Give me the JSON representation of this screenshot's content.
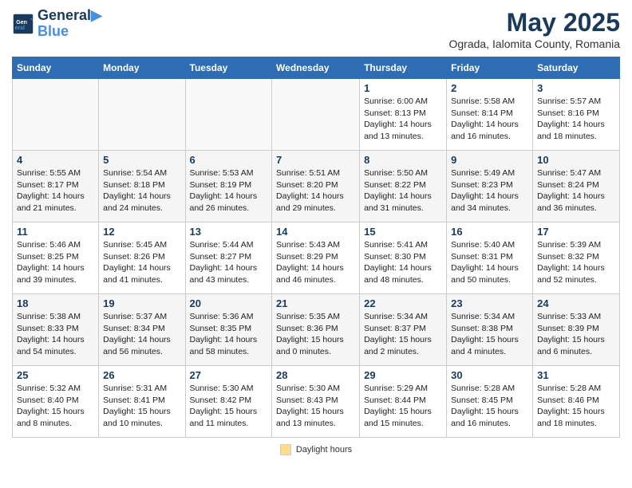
{
  "header": {
    "logo_line1": "General",
    "logo_line2": "Blue",
    "main_title": "May 2025",
    "subtitle": "Ograda, Ialomita County, Romania"
  },
  "days_of_week": [
    "Sunday",
    "Monday",
    "Tuesday",
    "Wednesday",
    "Thursday",
    "Friday",
    "Saturday"
  ],
  "weeks": [
    [
      {
        "num": "",
        "info": ""
      },
      {
        "num": "",
        "info": ""
      },
      {
        "num": "",
        "info": ""
      },
      {
        "num": "",
        "info": ""
      },
      {
        "num": "1",
        "info": "Sunrise: 6:00 AM\nSunset: 8:13 PM\nDaylight: 14 hours\nand 13 minutes."
      },
      {
        "num": "2",
        "info": "Sunrise: 5:58 AM\nSunset: 8:14 PM\nDaylight: 14 hours\nand 16 minutes."
      },
      {
        "num": "3",
        "info": "Sunrise: 5:57 AM\nSunset: 8:16 PM\nDaylight: 14 hours\nand 18 minutes."
      }
    ],
    [
      {
        "num": "4",
        "info": "Sunrise: 5:55 AM\nSunset: 8:17 PM\nDaylight: 14 hours\nand 21 minutes."
      },
      {
        "num": "5",
        "info": "Sunrise: 5:54 AM\nSunset: 8:18 PM\nDaylight: 14 hours\nand 24 minutes."
      },
      {
        "num": "6",
        "info": "Sunrise: 5:53 AM\nSunset: 8:19 PM\nDaylight: 14 hours\nand 26 minutes."
      },
      {
        "num": "7",
        "info": "Sunrise: 5:51 AM\nSunset: 8:20 PM\nDaylight: 14 hours\nand 29 minutes."
      },
      {
        "num": "8",
        "info": "Sunrise: 5:50 AM\nSunset: 8:22 PM\nDaylight: 14 hours\nand 31 minutes."
      },
      {
        "num": "9",
        "info": "Sunrise: 5:49 AM\nSunset: 8:23 PM\nDaylight: 14 hours\nand 34 minutes."
      },
      {
        "num": "10",
        "info": "Sunrise: 5:47 AM\nSunset: 8:24 PM\nDaylight: 14 hours\nand 36 minutes."
      }
    ],
    [
      {
        "num": "11",
        "info": "Sunrise: 5:46 AM\nSunset: 8:25 PM\nDaylight: 14 hours\nand 39 minutes."
      },
      {
        "num": "12",
        "info": "Sunrise: 5:45 AM\nSunset: 8:26 PM\nDaylight: 14 hours\nand 41 minutes."
      },
      {
        "num": "13",
        "info": "Sunrise: 5:44 AM\nSunset: 8:27 PM\nDaylight: 14 hours\nand 43 minutes."
      },
      {
        "num": "14",
        "info": "Sunrise: 5:43 AM\nSunset: 8:29 PM\nDaylight: 14 hours\nand 46 minutes."
      },
      {
        "num": "15",
        "info": "Sunrise: 5:41 AM\nSunset: 8:30 PM\nDaylight: 14 hours\nand 48 minutes."
      },
      {
        "num": "16",
        "info": "Sunrise: 5:40 AM\nSunset: 8:31 PM\nDaylight: 14 hours\nand 50 minutes."
      },
      {
        "num": "17",
        "info": "Sunrise: 5:39 AM\nSunset: 8:32 PM\nDaylight: 14 hours\nand 52 minutes."
      }
    ],
    [
      {
        "num": "18",
        "info": "Sunrise: 5:38 AM\nSunset: 8:33 PM\nDaylight: 14 hours\nand 54 minutes."
      },
      {
        "num": "19",
        "info": "Sunrise: 5:37 AM\nSunset: 8:34 PM\nDaylight: 14 hours\nand 56 minutes."
      },
      {
        "num": "20",
        "info": "Sunrise: 5:36 AM\nSunset: 8:35 PM\nDaylight: 14 hours\nand 58 minutes."
      },
      {
        "num": "21",
        "info": "Sunrise: 5:35 AM\nSunset: 8:36 PM\nDaylight: 15 hours\nand 0 minutes."
      },
      {
        "num": "22",
        "info": "Sunrise: 5:34 AM\nSunset: 8:37 PM\nDaylight: 15 hours\nand 2 minutes."
      },
      {
        "num": "23",
        "info": "Sunrise: 5:34 AM\nSunset: 8:38 PM\nDaylight: 15 hours\nand 4 minutes."
      },
      {
        "num": "24",
        "info": "Sunrise: 5:33 AM\nSunset: 8:39 PM\nDaylight: 15 hours\nand 6 minutes."
      }
    ],
    [
      {
        "num": "25",
        "info": "Sunrise: 5:32 AM\nSunset: 8:40 PM\nDaylight: 15 hours\nand 8 minutes."
      },
      {
        "num": "26",
        "info": "Sunrise: 5:31 AM\nSunset: 8:41 PM\nDaylight: 15 hours\nand 10 minutes."
      },
      {
        "num": "27",
        "info": "Sunrise: 5:30 AM\nSunset: 8:42 PM\nDaylight: 15 hours\nand 11 minutes."
      },
      {
        "num": "28",
        "info": "Sunrise: 5:30 AM\nSunset: 8:43 PM\nDaylight: 15 hours\nand 13 minutes."
      },
      {
        "num": "29",
        "info": "Sunrise: 5:29 AM\nSunset: 8:44 PM\nDaylight: 15 hours\nand 15 minutes."
      },
      {
        "num": "30",
        "info": "Sunrise: 5:28 AM\nSunset: 8:45 PM\nDaylight: 15 hours\nand 16 minutes."
      },
      {
        "num": "31",
        "info": "Sunrise: 5:28 AM\nSunset: 8:46 PM\nDaylight: 15 hours\nand 18 minutes."
      }
    ]
  ],
  "footer": {
    "daylight_label": "Daylight hours"
  }
}
